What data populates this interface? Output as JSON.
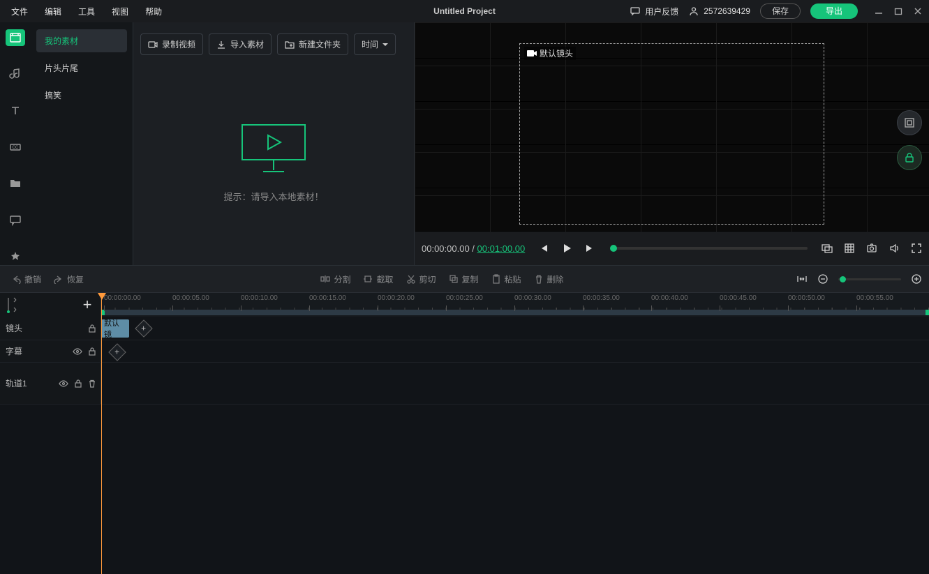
{
  "menubar": {
    "file": "文件",
    "edit": "编辑",
    "tools": "工具",
    "view": "视图",
    "help": "帮助"
  },
  "title": "Untitled Project",
  "titlebar_right": {
    "feedback": "用户反馈",
    "account": "2572639429",
    "save": "保存",
    "export": "导出"
  },
  "asset_nav": {
    "my_materials": "我的素材",
    "intros_outros": "片头片尾",
    "funny": "搞笑"
  },
  "asset_toolbar": {
    "record": "录制视频",
    "import": "导入素材",
    "new_folder": "新建文件夹",
    "sort": "时间"
  },
  "empty_hint": "提示：请导入本地素材！",
  "preview": {
    "current": "00:00:00.00",
    "separator": " / ",
    "total": "00:01:00.00",
    "default_shot": "默认镜头"
  },
  "editbar": {
    "undo": "撤销",
    "redo": "恢复",
    "split": "分割",
    "crop": "截取",
    "cut": "剪切",
    "copy": "复制",
    "paste": "粘贴",
    "delete": "删除"
  },
  "ruler_labels": [
    "00:00:00.00",
    "00:00:05.00",
    "00:00:10.00",
    "00:00:15.00",
    "00:00:20.00",
    "00:00:25.00",
    "00:00:30.00",
    "00:00:35.00",
    "00:00:40.00",
    "00:00:45.00",
    "00:00:50.00",
    "00:00:55.00"
  ],
  "tracks": {
    "shot": "镜头",
    "subtitle": "字幕",
    "track1": "轨道1",
    "default_clip": "默认镜"
  }
}
